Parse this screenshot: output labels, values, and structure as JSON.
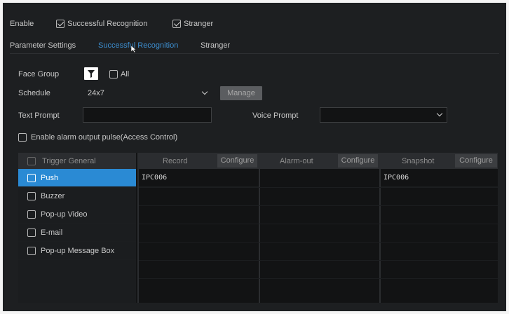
{
  "enable_bar": {
    "label": "Enable",
    "successful_recognition": {
      "label": "Successful Recognition",
      "checked": true
    },
    "stranger": {
      "label": "Stranger",
      "checked": true
    }
  },
  "tabs": [
    {
      "label": "Parameter Settings",
      "active": false
    },
    {
      "label": "Successful Recognition",
      "active": true
    },
    {
      "label": "Stranger",
      "active": false
    }
  ],
  "form": {
    "face_group": {
      "label": "Face Group",
      "all_label": "All",
      "all_checked": false,
      "filter_icon": "filter-icon"
    },
    "schedule": {
      "label": "Schedule",
      "value": "24x7",
      "manage_label": "Manage"
    },
    "text_prompt": {
      "label": "Text Prompt",
      "value": ""
    },
    "voice_prompt": {
      "label": "Voice Prompt",
      "value": ""
    },
    "alarm_output": {
      "label": "Enable alarm output pulse(Access Control)",
      "checked": false
    }
  },
  "trigger": {
    "header": "Trigger General",
    "items": [
      {
        "label": "Push",
        "checked": false,
        "selected": true
      },
      {
        "label": "Buzzer",
        "checked": false,
        "selected": false
      },
      {
        "label": "Pop-up Video",
        "checked": false,
        "selected": false
      },
      {
        "label": "E-mail",
        "checked": false,
        "selected": false
      },
      {
        "label": "Pop-up Message Box",
        "checked": false,
        "selected": false
      }
    ]
  },
  "record": {
    "header": "Record",
    "configure": "Configure",
    "rows": [
      "IPC006"
    ]
  },
  "alarm_out": {
    "header": "Alarm-out",
    "configure": "Configure",
    "rows": []
  },
  "snapshot": {
    "header": "Snapshot",
    "configure": "Configure",
    "rows": [
      "IPC006"
    ]
  },
  "colors": {
    "background": "#1d1f21",
    "accent": "#3d8fd1",
    "selected_row": "#2a8ad4"
  }
}
